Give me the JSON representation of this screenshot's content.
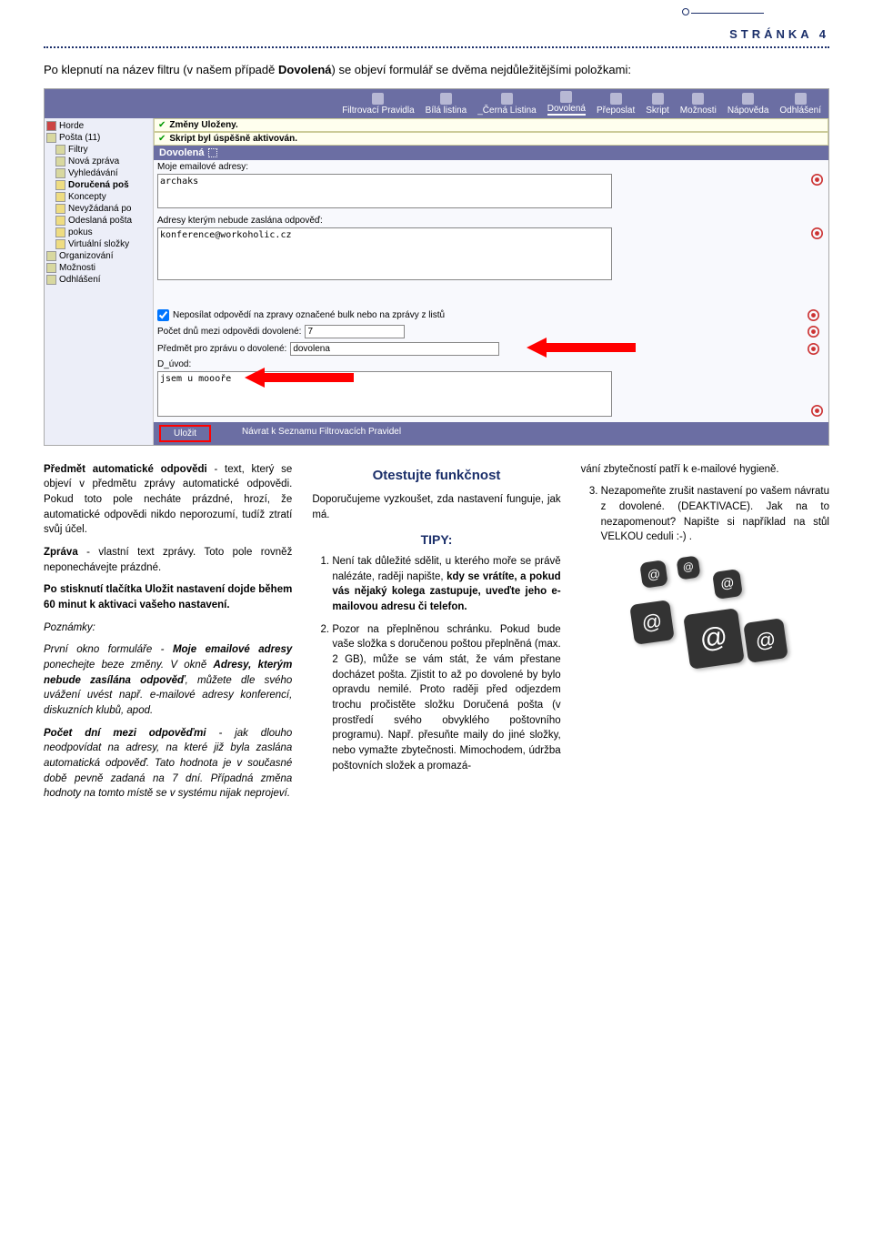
{
  "page_label": "STRÁNKA 4",
  "intro_a": "Po klepnutí na název filtru (v našem případě ",
  "intro_bold": "Dovolená",
  "intro_b": ") se objeví formulář se dvěma nejdůležitějšími položkami:",
  "topbar": {
    "items": [
      "Filtrovací Pravidla",
      "Bílá listina",
      "_Černá Listina",
      "Dovolená",
      "Přeposlat",
      "Skript",
      "Možnosti",
      "Nápověda",
      "Odhlášení"
    ]
  },
  "tree": [
    {
      "cls": "",
      "lbl": "Horde"
    },
    {
      "cls": "",
      "lbl": "Pošta (11)"
    },
    {
      "cls": "i1",
      "lbl": "Filtry"
    },
    {
      "cls": "i1",
      "lbl": "Nová zpráva"
    },
    {
      "cls": "i1",
      "lbl": "Vyhledávání"
    },
    {
      "cls": "i1",
      "lbl": "Doručená poš"
    },
    {
      "cls": "i1",
      "lbl": "Koncepty"
    },
    {
      "cls": "i1",
      "lbl": "Nevyžádaná po"
    },
    {
      "cls": "i1",
      "lbl": "Odeslaná pošta"
    },
    {
      "cls": "i1",
      "lbl": "pokus"
    },
    {
      "cls": "i1",
      "lbl": "Virtuální složky"
    },
    {
      "cls": "",
      "lbl": "Organizování"
    },
    {
      "cls": "",
      "lbl": "Možnosti"
    },
    {
      "cls": "",
      "lbl": "Odhlášení"
    }
  ],
  "status1": "Změny Uloženy.",
  "status2": "Skript byl úspěšně aktivován.",
  "header_bar": "Dovolená",
  "lbl_my_addr": "Moje emailové adresy:",
  "val_my_addr": "archaks",
  "lbl_noreply": "Adresy kterým nebude zaslána odpověď:",
  "val_noreply": "konference@workoholic.cz",
  "lbl_bulk": "Neposílat odpovědí na zpravy označené bulk nebo na zprávy z listů",
  "lbl_days": "Počet dnů mezi odpovědi dovolené:",
  "val_days": "7",
  "lbl_subj": "Předmět pro zprávu o dovolené:",
  "val_subj": "dovolena",
  "lbl_d": "D_úvod:",
  "val_body": "jsem u moooře",
  "btn_save": "Uložit",
  "btn_back": "Návrat k Seznamu Filtrovacích Pravidel",
  "col1": {
    "p1a": "Předmět automatické odpovědi",
    "p1b": " - text, který se objeví v předmětu zprávy automatické odpovědi. Pokud toto pole necháte prázdné, hrozí, že automatické odpovědi nikdo neporozumí, tudíž ztratí svůj účel.",
    "p2a": "Zpráva",
    "p2b": " - vlastní text zprávy. Toto pole rovněž neponechávejte prázdné.",
    "p3": "Po stisknutí tlačítka Uložit nastavení dojde během 60 minut k aktivaci vašeho nastavení.",
    "p4h": "Poznámky:",
    "p4a": "První okno formuláře - ",
    "p4b": "Moje emailové adresy",
    "p4c": " ponechejte beze změny. V okně ",
    "p4d": "Adresy, kterým nebude zasílána odpověď",
    "p4e": ", můžete dle svého uvážení uvést např. e-mailové adresy konferencí, diskuzních klubů, apod.",
    "p5a": "Počet dní mezi odpověďmi",
    "p5b": " - jak dlouho neodpovídat na adresy, na které již byla zaslána automatická odpověď. Tato hodnota je v současné době pevně zadaná na 7 dní. Případná změna hodnoty na tomto místě se v systému nijak neprojeví."
  },
  "col2": {
    "h": "Otestujte funkčnost",
    "p1": "Doporučujeme vyzkoušet, zda nastavení funguje, jak má.",
    "h2": "TIPY:",
    "li1a": "Není tak důležité sdělit, u kterého moře se právě nalézáte, raději napište, ",
    "li1b": "kdy se vrátíte, a pokud vás nějaký kolega zastupuje, uveďte jeho e-mailovou adresu či telefon.",
    "li2": "Pozor na přeplněnou schránku. Pokud bude vaše složka s doručenou poštou přeplněná (max. 2 GB), může se vám stát, že vám přestane docházet pošta. Zjistit to až po dovolené by bylo opravdu nemilé. Proto raději před odjezdem trochu pročistěte složku Doručená pošta (v prostředí svého obvyklého poštovního programu). Např. přesuňte maily do jiné složky, nebo vymažte zbytečnosti. Mimochodem, údržba poštovních složek a promazá-"
  },
  "col3": {
    "cont": "vání zbytečností patří k e-mailové hygieně.",
    "li3": "Nezapomeňte zrušit nastavení po vašem návratu z dovolené. (DEAKTIVACE). Jak na to nezapomenout? Napište si například na stůl VELKOU ceduli :-) ."
  }
}
